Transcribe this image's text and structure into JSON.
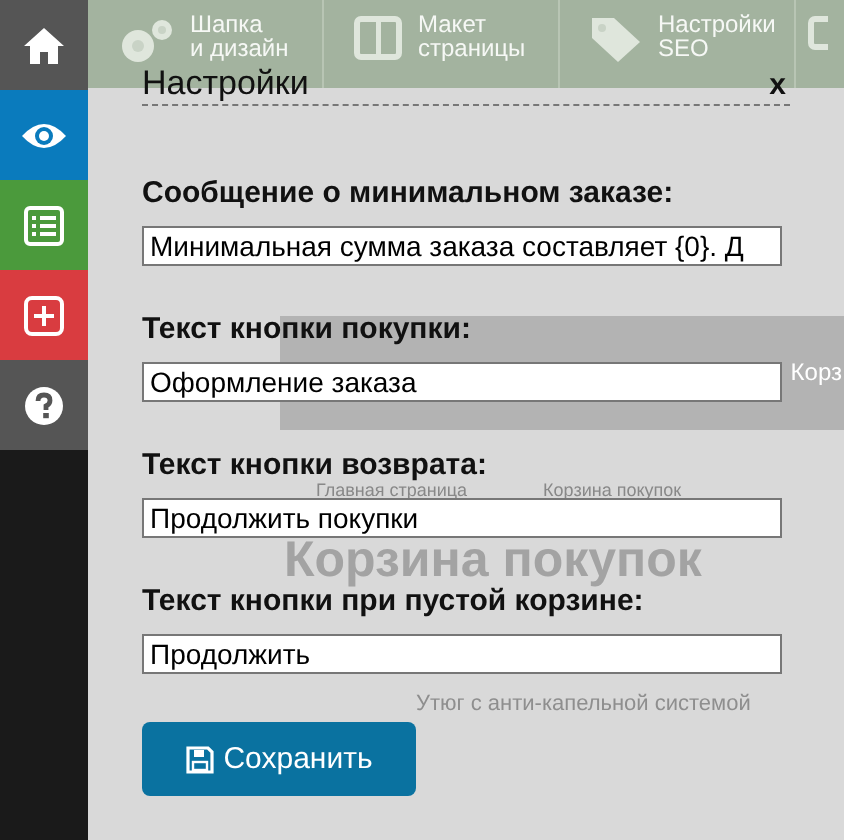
{
  "sidebar": {
    "items": [
      {
        "color": "#555555"
      },
      {
        "color": "#0a7bbd"
      },
      {
        "color": "#4b9a3c"
      },
      {
        "color": "#d93c40"
      },
      {
        "color": "#555555"
      }
    ]
  },
  "background_page": {
    "toolbar": [
      {
        "lines": [
          "Шапка",
          "и дизайн"
        ]
      },
      {
        "lines": [
          "Макет",
          "страницы"
        ]
      },
      {
        "lines": [
          "Настройки",
          "SEO"
        ]
      }
    ],
    "cart_bar_text": "Корз",
    "breadcrumbs": [
      "Главная страница",
      "Корзина покупок"
    ],
    "heading": "Корзина покупок",
    "product": "Утюг с анти-капельной системой"
  },
  "dialog": {
    "title": "Настройки",
    "close": "x",
    "fields": [
      {
        "label": "Сообщение о минимальном заказе:",
        "value": "Минимальная сумма заказа составляет {0}. Д"
      },
      {
        "label": "Текст кнопки покупки:",
        "value": "Оформление заказа"
      },
      {
        "label": "Текст кнопки возврата:",
        "value": "Продолжить покупки"
      },
      {
        "label": "Текст кнопки при пустой корзине:",
        "value": "Продолжить"
      }
    ],
    "save_button": "Сохранить"
  }
}
